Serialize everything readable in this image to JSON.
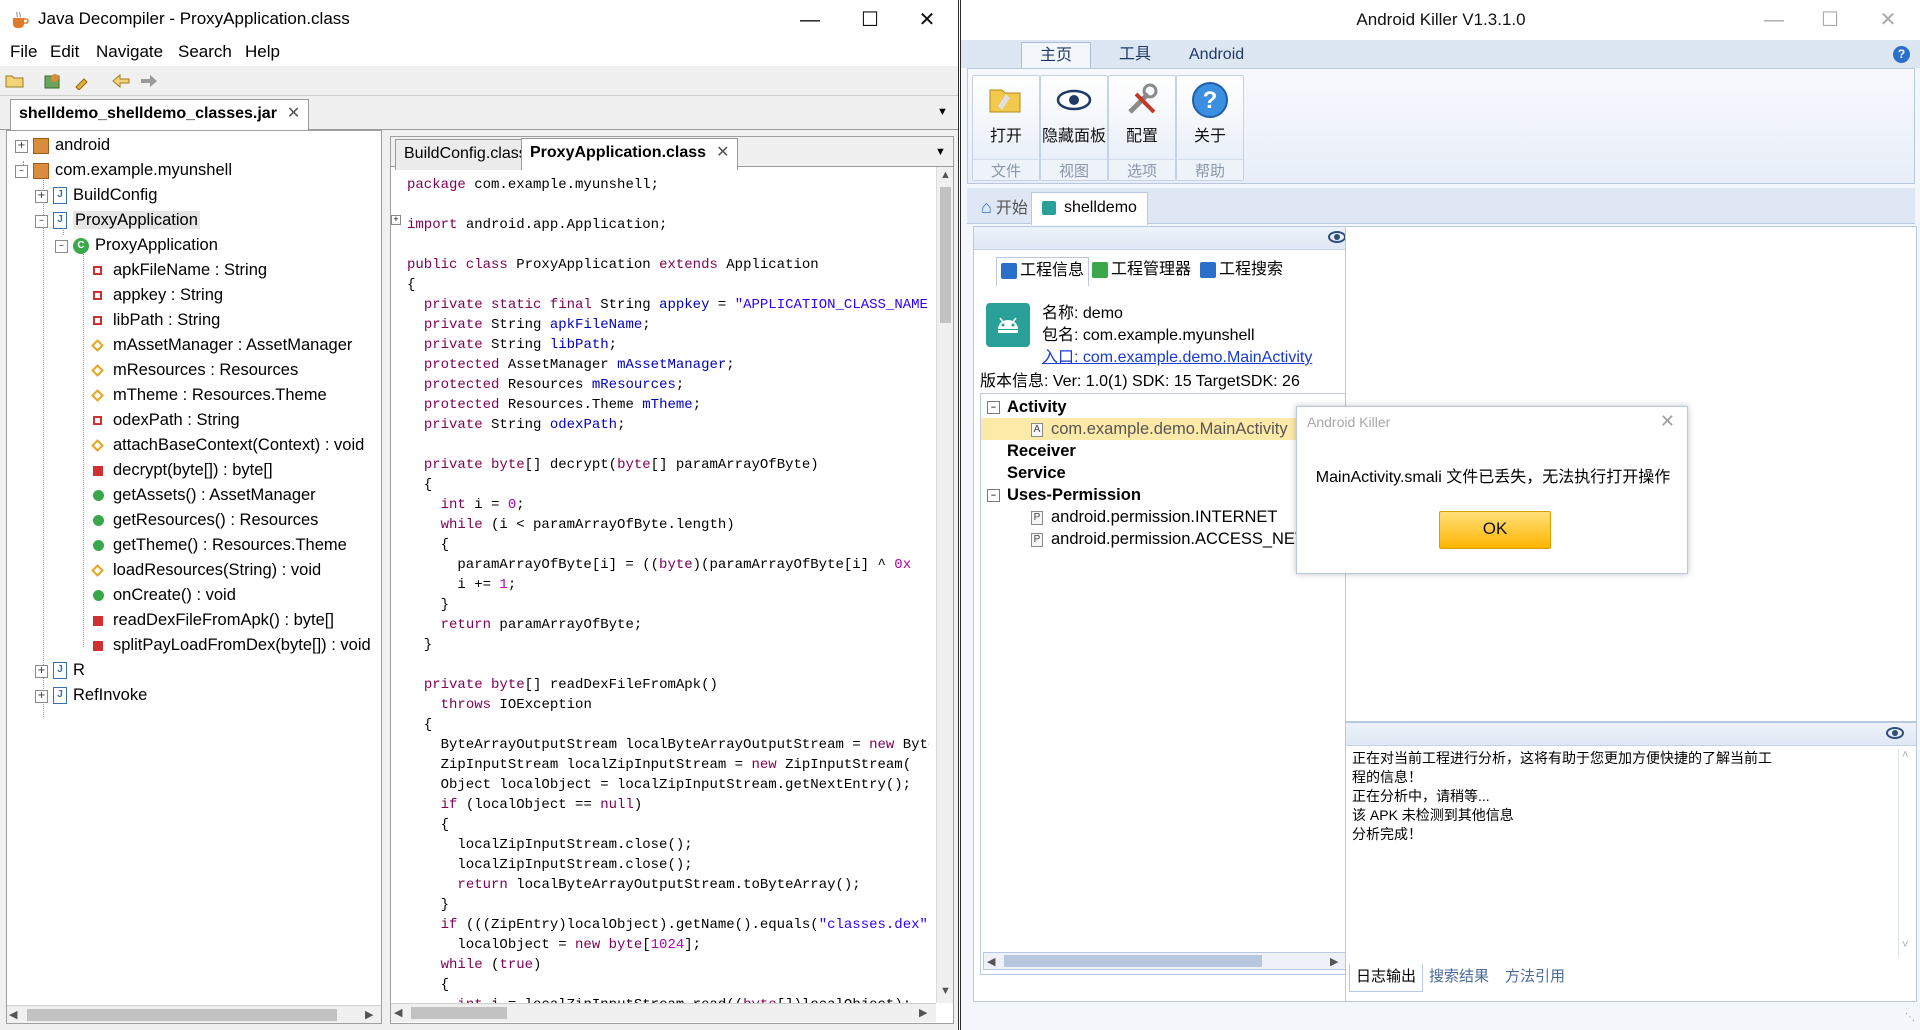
{
  "jd": {
    "title": "Java Decompiler - ProxyApplication.class",
    "menu": [
      "File",
      "Edit",
      "Navigate",
      "Search",
      "Help"
    ],
    "jar_tab": "shelldemo_shelldemo_classes.jar",
    "tree": {
      "android": "android",
      "package": "com.example.myunshell",
      "buildconfig": "BuildConfig",
      "proxyapp_file": "ProxyApplication",
      "proxyapp_class": "ProxyApplication",
      "members": [
        "apkFileName : String",
        "appkey : String",
        "libPath : String",
        "mAssetManager : AssetManager",
        "mResources : Resources",
        "mTheme : Resources.Theme",
        "odexPath : String",
        "attachBaseContext(Context) : void",
        "decrypt(byte[]) : byte[]",
        "getAssets() : AssetManager",
        "getResources() : Resources",
        "getTheme() : Resources.Theme",
        "loadResources(String) : void",
        "onCreate() : void",
        "readDexFileFromApk() : byte[]",
        "splitPayLoadFromDex(byte[]) : void"
      ],
      "r": "R",
      "refinvoke": "RefInvoke"
    },
    "code_tabs": [
      "BuildConfig.class",
      "ProxyApplication.class"
    ]
  },
  "ak": {
    "title": "Android Killer V1.3.1.0",
    "ribbon_tabs": [
      "主页",
      "工具",
      "Android"
    ],
    "ribbon_groups": [
      {
        "label": "打开",
        "group": "文件",
        "icon": "folder-open-icon"
      },
      {
        "label": "隐藏面板",
        "group": "视图",
        "icon": "eye-icon"
      },
      {
        "label": "配置",
        "group": "选项",
        "icon": "tools-icon"
      },
      {
        "label": "关于",
        "group": "帮助",
        "icon": "help-icon"
      }
    ],
    "doc_tabs": [
      "开始",
      "shelldemo"
    ],
    "sub_tabs": [
      "工程信息",
      "工程管理器",
      "工程搜索"
    ],
    "info": {
      "name": "名称: demo",
      "package": "包名: com.example.myunshell",
      "entry_label": "入口: ",
      "entry_value": "com.example.demo.MainActivity",
      "version": "版本信息:  Ver: 1.0(1) SDK: 15 TargetSDK: 26"
    },
    "tree": {
      "activity": "Activity",
      "activity_item": "com.example.demo.MainActivity",
      "receiver": "Receiver",
      "service": "Service",
      "uses_permission": "Uses-Permission",
      "perm1": "android.permission.INTERNET",
      "perm2": "android.permission.ACCESS_NET"
    },
    "log_lines": [
      "正在对当前工程进行分析，这将有助于您更加方便快捷的了解当前工",
      "程的信息！",
      "正在分析中，请稍等...",
      "该 APK 未检测到其他信息",
      "分析完成！"
    ],
    "log_tabs": [
      "日志输出",
      "搜索结果",
      "方法引用"
    ],
    "dialog": {
      "title": "Android Killer",
      "message": "MainActivity.smali 文件已丢失，无法执行打开操作",
      "ok": "OK"
    }
  }
}
